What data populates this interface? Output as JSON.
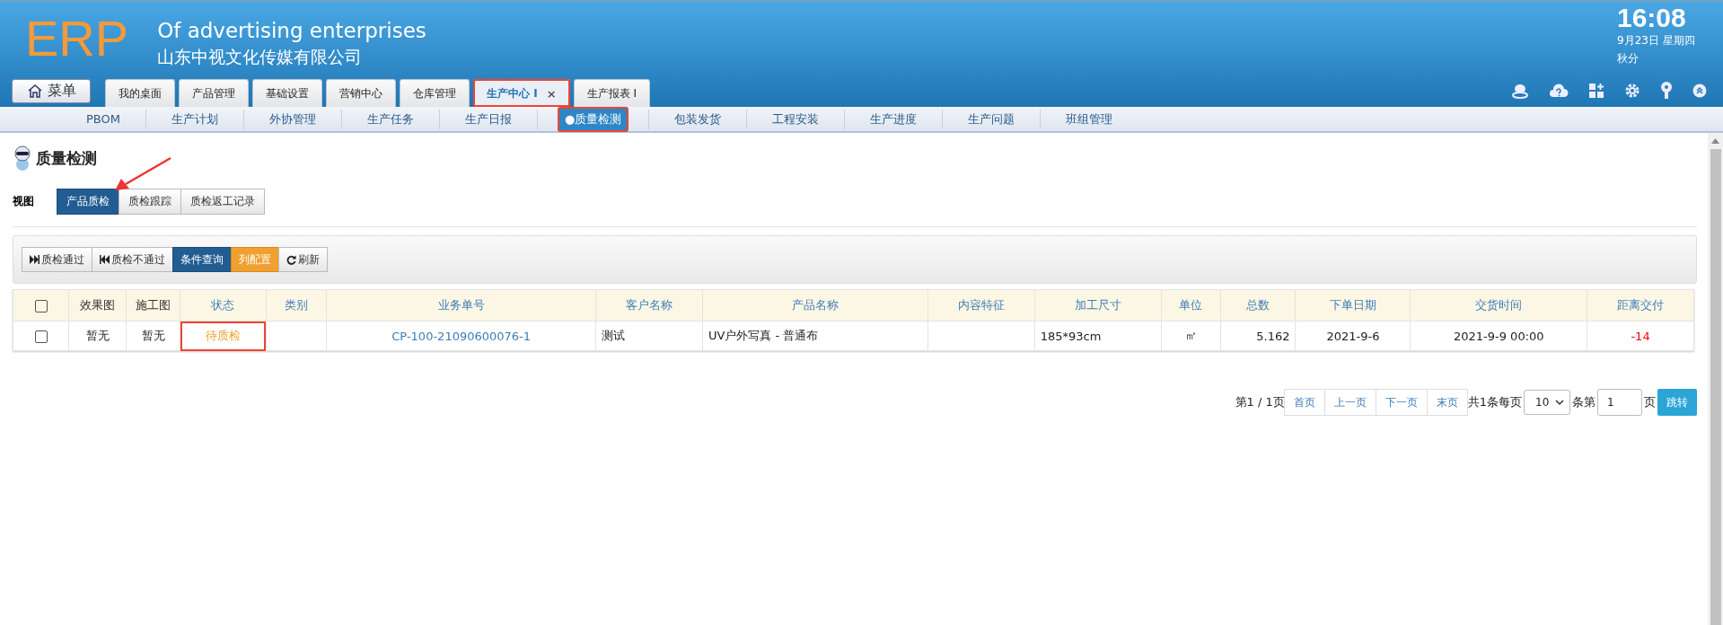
{
  "header": {
    "logo": "ERP",
    "tagline": "Of advertising enterprises",
    "company": "山东中视文化传媒有限公司",
    "clock": {
      "time": "16:08",
      "date": "9月23日 星期四",
      "term": "秋分"
    },
    "menu_button": "菜单",
    "tabs": [
      {
        "label": "我的桌面",
        "selected": false,
        "highlighted": false
      },
      {
        "label": "产品管理",
        "selected": false,
        "highlighted": false
      },
      {
        "label": "基础设置",
        "selected": false,
        "highlighted": false
      },
      {
        "label": "营销中心",
        "selected": false,
        "highlighted": false
      },
      {
        "label": "仓库管理",
        "selected": false,
        "highlighted": false
      },
      {
        "label": "生产中心 I",
        "selected": true,
        "highlighted": true,
        "close": "×"
      },
      {
        "label": "生产报表 I",
        "selected": false,
        "highlighted": false
      }
    ]
  },
  "subnav": [
    {
      "label": "PBOM",
      "selected": false,
      "highlighted": false
    },
    {
      "label": "生产计划",
      "selected": false,
      "highlighted": false
    },
    {
      "label": "外协管理",
      "selected": false,
      "highlighted": false
    },
    {
      "label": "生产任务",
      "selected": false,
      "highlighted": false
    },
    {
      "label": "生产日报",
      "selected": false,
      "highlighted": false
    },
    {
      "label": "●质量检测",
      "selected": true,
      "highlighted": true
    },
    {
      "label": "包装发货",
      "selected": false,
      "highlighted": false
    },
    {
      "label": "工程安装",
      "selected": false,
      "highlighted": false
    },
    {
      "label": "生产进度",
      "selected": false,
      "highlighted": false
    },
    {
      "label": "生产问题",
      "selected": false,
      "highlighted": false
    },
    {
      "label": "班组管理",
      "selected": false,
      "highlighted": false
    }
  ],
  "page": {
    "title": "质量检测",
    "view_label": "视图",
    "views": [
      {
        "label": "产品质检",
        "selected": true
      },
      {
        "label": "质检跟踪",
        "selected": false
      },
      {
        "label": "质检返工记录",
        "selected": false
      }
    ],
    "toolbar": [
      {
        "label": "质检通过",
        "kind": "forward"
      },
      {
        "label": "质检不通过",
        "kind": "back"
      },
      {
        "label": "条件查询",
        "kind": "primary"
      },
      {
        "label": "列配置",
        "kind": "warning"
      },
      {
        "label": "刷新",
        "kind": "refresh"
      }
    ],
    "table": {
      "columns": [
        {
          "label": "效果图"
        },
        {
          "label": "施工图"
        },
        {
          "label": "状态"
        },
        {
          "label": "类别"
        },
        {
          "label": "业务单号"
        },
        {
          "label": "客户名称"
        },
        {
          "label": "产品名称"
        },
        {
          "label": "内容特征"
        },
        {
          "label": "加工尺寸"
        },
        {
          "label": "单位"
        },
        {
          "label": "总数"
        },
        {
          "label": "下单日期"
        },
        {
          "label": "交货时间"
        },
        {
          "label": "距离交付"
        }
      ],
      "header_checked": false,
      "rows": [
        {
          "checked": false,
          "status_highlighted": true,
          "cells": [
            "暂无",
            "暂无",
            "待质检",
            "",
            "CP-100-21090600076-1",
            "测试",
            "UV户外写真 - 普通布",
            "",
            "185*93cm",
            "㎡",
            "5.162",
            "2021-9-6",
            "2021-9-9 00:00",
            "-14"
          ]
        }
      ]
    },
    "pagination": {
      "page_info": "第1 / 1页",
      "buttons": [
        "首页",
        "上一页",
        "下一页",
        "末页"
      ],
      "total": "共1条每页",
      "page_size": "10",
      "per_label": "条第",
      "page_input": "1",
      "page_suffix": "页",
      "go": "跳转"
    }
  }
}
